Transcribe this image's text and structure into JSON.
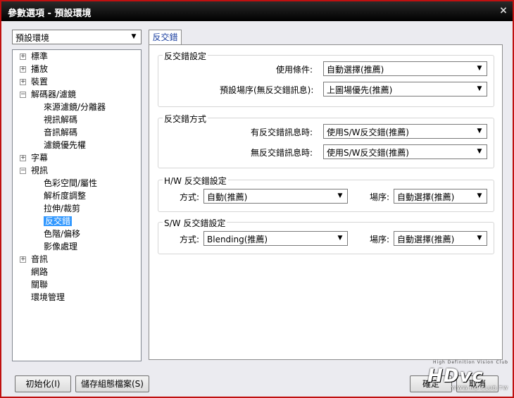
{
  "window": {
    "title": "參數選項 - 預設環境",
    "close_glyph": "×"
  },
  "profile_combo": {
    "value": "預設環境"
  },
  "tree": {
    "items": [
      {
        "label": "標準",
        "expander": "+"
      },
      {
        "label": "播放",
        "expander": "+"
      },
      {
        "label": "裝置",
        "expander": "+"
      },
      {
        "label": "解碼器/濾鏡",
        "expander": "−"
      },
      {
        "label": "來源濾鏡/分離器"
      },
      {
        "label": "視訊解碼"
      },
      {
        "label": "音訊解碼"
      },
      {
        "label": "濾鏡優先權"
      },
      {
        "label": "字幕",
        "expander": "+"
      },
      {
        "label": "視訊",
        "expander": "−"
      },
      {
        "label": "色彩空間/屬性"
      },
      {
        "label": "解析度調整"
      },
      {
        "label": "拉伸/裁剪"
      },
      {
        "label": "反交錯",
        "selected": true
      },
      {
        "label": "色階/偏移"
      },
      {
        "label": "影像處理"
      },
      {
        "label": "音訊",
        "expander": "+"
      },
      {
        "label": "網路"
      },
      {
        "label": "關聯"
      },
      {
        "label": "環境管理"
      }
    ]
  },
  "tab": {
    "label": "反交錯"
  },
  "deint_settings": {
    "title": "反交錯設定",
    "condition_label": "使用條件:",
    "condition_value": "自動選擇(推薦)",
    "field_order_label": "預設場序(無反交錯訊息):",
    "field_order_value": "上圖場優先(推薦)"
  },
  "deint_method": {
    "title": "反交錯方式",
    "with_info_label": "有反交錯訊息時:",
    "with_info_value": "使用S/W反交錯(推薦)",
    "without_info_label": "無反交錯訊息時:",
    "without_info_value": "使用S/W反交錯(推薦)"
  },
  "hw_settings": {
    "title": "H/W 反交錯設定",
    "method_label": "方式:",
    "method_value": "自動(推薦)",
    "field_order_label": "場序:",
    "field_order_value": "自動選擇(推薦)"
  },
  "sw_settings": {
    "title": "S/W 反交錯設定",
    "method_label": "方式:",
    "method_value": "Blending(推薦)",
    "field_order_label": "場序:",
    "field_order_value": "自動選擇(推薦)"
  },
  "buttons": {
    "init": "初始化(I)",
    "save_profile": "儲存組態檔案(S)",
    "ok": "確定",
    "cancel": "取消"
  },
  "watermark": {
    "small": "High Definition Vision Club",
    "logo": "HDvc",
    "url": "WWW.HD.CLUB.TW"
  }
}
